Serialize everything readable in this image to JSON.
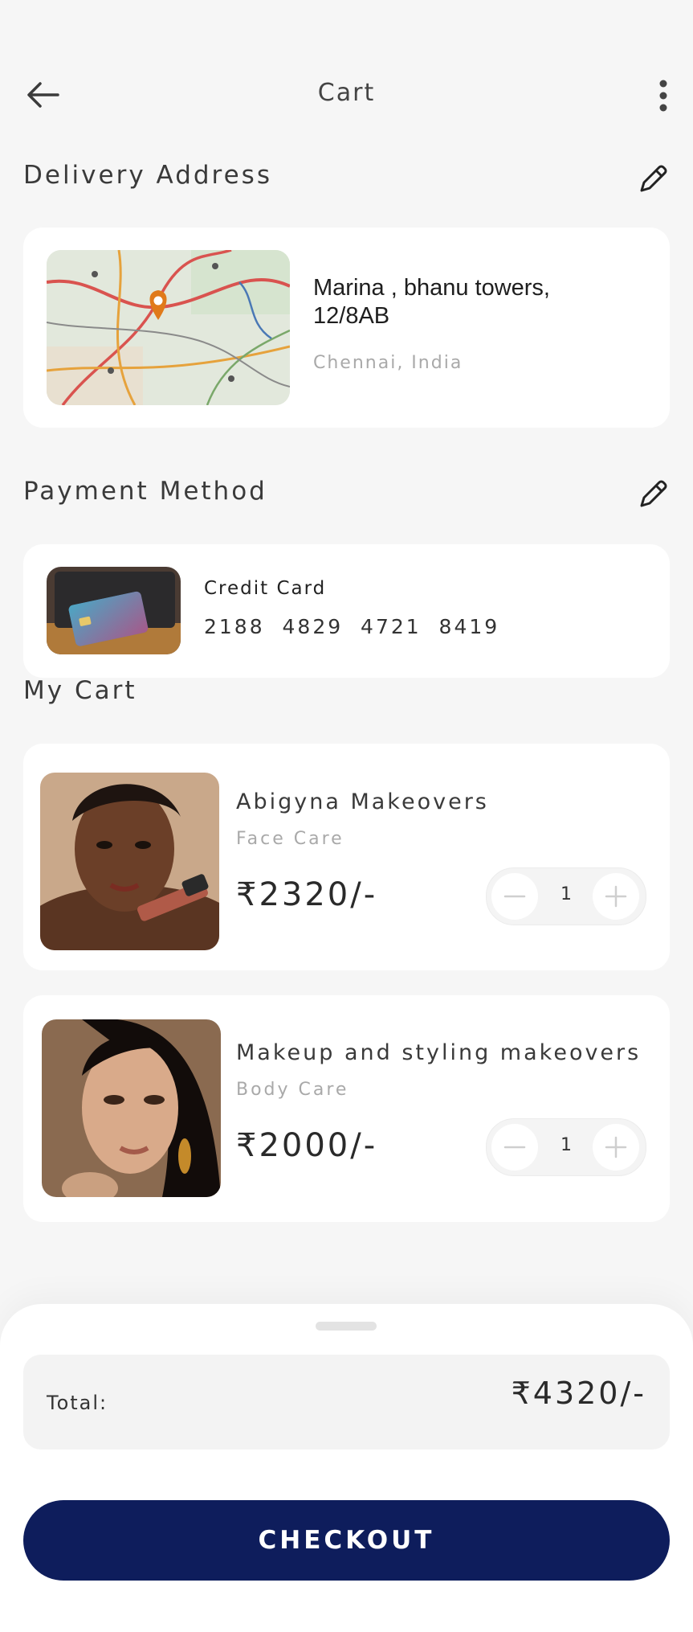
{
  "header": {
    "title": "Cart",
    "back_icon": "arrow-left-icon",
    "menu_icon": "more-vertical-icon"
  },
  "delivery": {
    "section_title": "Delivery Address",
    "edit_icon": "pencil-icon",
    "address_line": "Marina , bhanu towers, 12/8AB",
    "city": "Chennai, India",
    "map_icon": "map-thumbnail",
    "pin_color": "#e07a1a"
  },
  "payment": {
    "section_title": "Payment Method",
    "edit_icon": "pencil-icon",
    "card_type": "Credit Card",
    "card_number": "2188  4829  4721  8419"
  },
  "cart": {
    "section_title": "My Cart",
    "items": [
      {
        "name": "Abigyna Makeovers",
        "category": "Face Care",
        "price": "₹2320/-",
        "qty": "1"
      },
      {
        "name": "Makeup and styling makeovers",
        "category": "Body Care",
        "price": "₹2000/-",
        "qty": "1"
      }
    ]
  },
  "summary": {
    "total_label": "Total:",
    "total_value": "₹4320/-",
    "checkout_label": "CHECKOUT"
  },
  "colors": {
    "accent": "#0e1d5c",
    "background": "#f6f6f6",
    "card": "#ffffff",
    "muted_text": "#a9a9a9"
  }
}
